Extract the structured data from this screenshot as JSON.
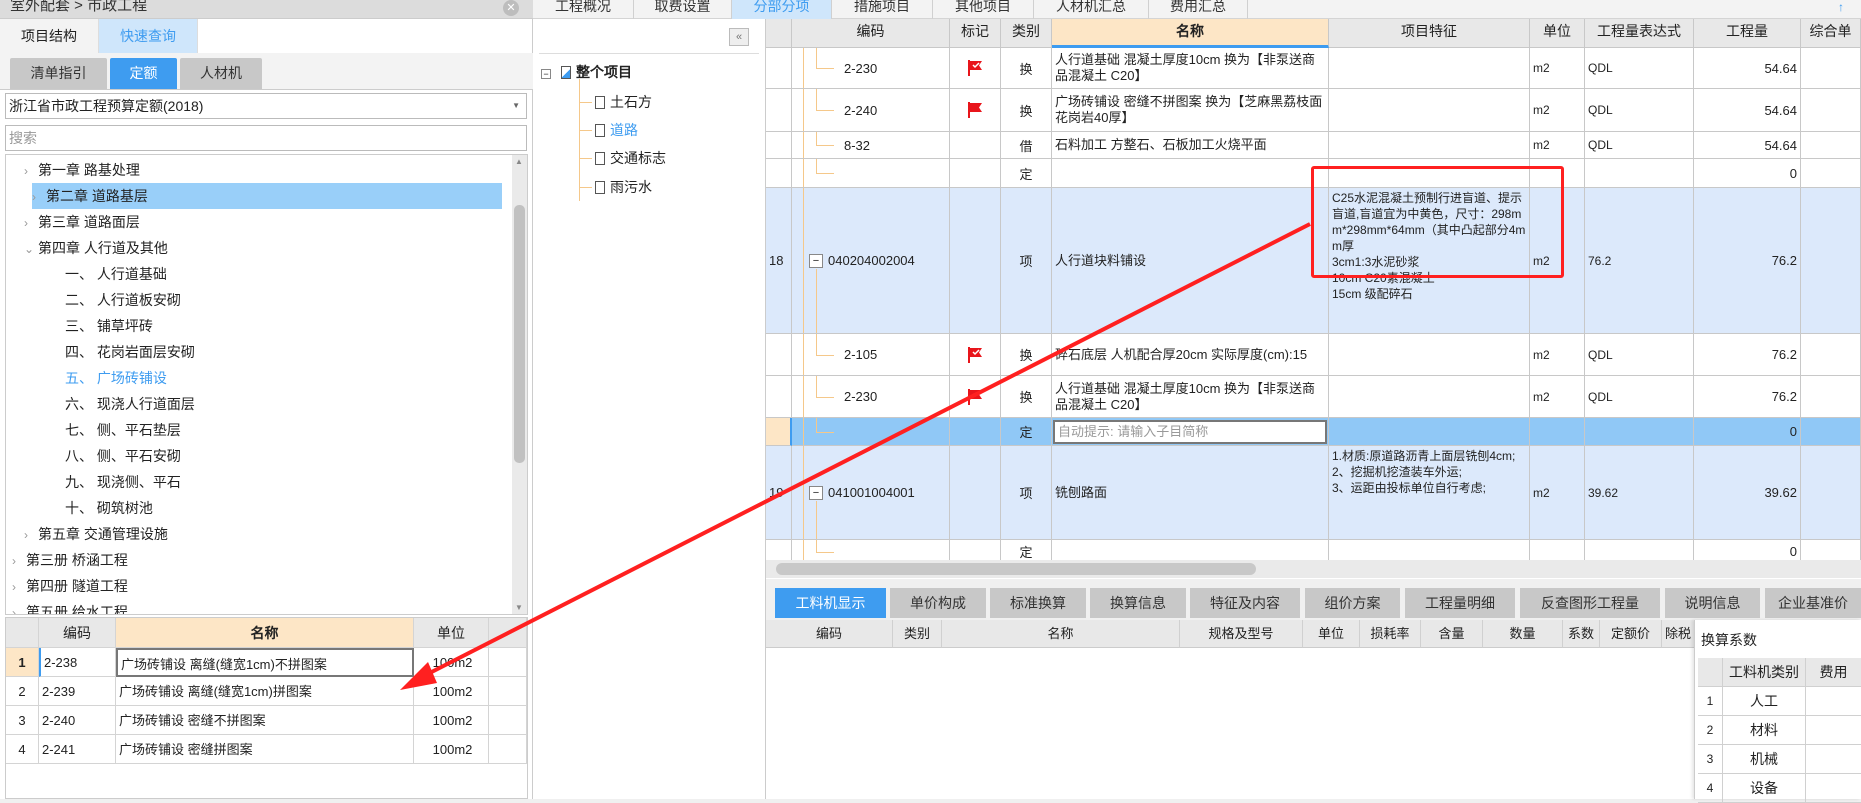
{
  "window": {
    "breadcrumb": "室外配套 > 市政工程",
    "close_icon": "close-circle-icon"
  },
  "top_tabs": [
    {
      "label": "工程概况",
      "active": false
    },
    {
      "label": "取费设置",
      "active": false
    },
    {
      "label": "分部分项",
      "active": true
    },
    {
      "label": "措施项目",
      "active": false
    },
    {
      "label": "其他项目",
      "active": false
    },
    {
      "label": "人材机汇总",
      "active": false
    },
    {
      "label": "费用汇总",
      "active": false
    }
  ],
  "left_panel": {
    "tabs": [
      {
        "label": "项目结构",
        "active": false
      },
      {
        "label": "快速查询",
        "active": true
      }
    ],
    "sub_tabs": [
      {
        "label": "清单指引",
        "active": false
      },
      {
        "label": "定额",
        "active": true
      },
      {
        "label": "人材机",
        "active": false
      }
    ],
    "library": "浙江省市政工程预算定额(2018)",
    "search_placeholder": "搜索",
    "tree": [
      {
        "label": "第一章  路基处理",
        "level": 1,
        "expander": "collapsed"
      },
      {
        "label": "第二章  道路基层",
        "level": 1,
        "expander": "collapsed",
        "highlighted": true
      },
      {
        "label": "第三章  道路面层",
        "level": 1,
        "expander": "collapsed"
      },
      {
        "label": "第四章  人行道及其他",
        "level": 1,
        "expander": "expanded"
      },
      {
        "label": "一、  人行道基础",
        "level": 2
      },
      {
        "label": "二、  人行道板安砌",
        "level": 2
      },
      {
        "label": "三、  铺草坪砖",
        "level": 2
      },
      {
        "label": "四、  花岗岩面层安砌",
        "level": 2
      },
      {
        "label": "五、  广场砖铺设",
        "level": 2,
        "selected": true
      },
      {
        "label": "六、  现浇人行道面层",
        "level": 2
      },
      {
        "label": "七、  侧、平石垫层",
        "level": 2
      },
      {
        "label": "八、  侧、平石安砌",
        "level": 2
      },
      {
        "label": "九、  现浇侧、平石",
        "level": 2
      },
      {
        "label": "十、  砌筑树池",
        "level": 2
      },
      {
        "label": "第五章  交通管理设施",
        "level": 1,
        "expander": "collapsed"
      },
      {
        "label": "第三册  桥涵工程",
        "level": 0,
        "expander": "collapsed"
      },
      {
        "label": "第四册  隧道工程",
        "level": 0,
        "expander": "collapsed"
      },
      {
        "label": "第五册  给水工程",
        "level": 0,
        "expander": "collapsed"
      }
    ],
    "result_table": {
      "headers": [
        "编码",
        "名称",
        "单位"
      ],
      "rows": [
        {
          "index": "1",
          "code": "2-238",
          "name": "广场砖铺设  离缝(缝宽1cm)不拼图案",
          "unit": "100m2"
        },
        {
          "index": "2",
          "code": "2-239",
          "name": "广场砖铺设  离缝(缝宽1cm)拼图案",
          "unit": "100m2"
        },
        {
          "index": "3",
          "code": "2-240",
          "name": "广场砖铺设  密缝不拼图案",
          "unit": "100m2"
        },
        {
          "index": "4",
          "code": "2-241",
          "name": "广场砖铺设  密缝拼图案",
          "unit": "100m2"
        }
      ]
    }
  },
  "project_tree": {
    "root": "整个项目",
    "children": [
      {
        "label": "土石方",
        "selected": false
      },
      {
        "label": "道路",
        "selected": true
      },
      {
        "label": "交通标志",
        "selected": false
      },
      {
        "label": "雨污水",
        "selected": false
      }
    ]
  },
  "main_table": {
    "headers": [
      "",
      "编码",
      "标记",
      "类别",
      "名称",
      "项目特征",
      "单位",
      "工程量表达式",
      "工程量",
      "综合单"
    ],
    "rows": [
      {
        "num": "",
        "code": "2-230",
        "flag": "flag-check",
        "type": "换",
        "name": "人行道基础 混凝土厚度10cm   换为【非泵送商品混凝土 C20】",
        "feature": "",
        "unit": "m2",
        "expr": "QDL",
        "qty": "54.64"
      },
      {
        "num": "",
        "code": "2-240",
        "flag": "flag",
        "type": "换",
        "name": "广场砖铺设 密缝不拼图案   换为【芝麻黑荔枝面花岗岩40厚】",
        "feature": "",
        "unit": "m2",
        "expr": "QDL",
        "qty": "54.64"
      },
      {
        "num": "",
        "code": "8-32",
        "flag": "",
        "type": "借",
        "name": "石料加工 方整石、石板加工火烧平面",
        "feature": "",
        "unit": "m2",
        "expr": "QDL",
        "qty": "54.64"
      },
      {
        "num": "",
        "code": "",
        "flag": "",
        "type": "定",
        "name": "",
        "feature": "",
        "unit": "",
        "expr": "",
        "qty": "0"
      },
      {
        "num": "18",
        "code": "040204002004",
        "flag": "",
        "type": "项",
        "name": "人行道块料铺设",
        "feature": "C25水泥混凝土预制行进盲道、提示盲道,盲道宜为中黄色，尺寸：298mm*298mm*64mm（其中凸起部分4mm厚\n3cm1:3水泥砂浆\n10cm C20素混凝土\n15cm 级配碎石",
        "unit": "m2",
        "expr": "76.2",
        "qty": "76.2",
        "parent": true
      },
      {
        "num": "",
        "code": "2-105",
        "flag": "flag-check",
        "type": "换",
        "name": "碎石底层 人机配合厚20cm   实际厚度(cm):15",
        "feature": "",
        "unit": "m2",
        "expr": "QDL",
        "qty": "76.2"
      },
      {
        "num": "",
        "code": "2-230",
        "flag": "flag-check",
        "type": "换",
        "name": "人行道基础 混凝土厚度10cm   换为【非泵送商品混凝土 C20】",
        "feature": "",
        "unit": "m2",
        "expr": "QDL",
        "qty": "76.2"
      },
      {
        "num": "",
        "code": "",
        "flag": "",
        "type": "定",
        "name": "",
        "name_placeholder": "自动提示: 请输入子目简称",
        "feature": "",
        "unit": "",
        "expr": "",
        "qty": "0",
        "editing": true
      },
      {
        "num": "19",
        "code": "041001004001",
        "flag": "",
        "type": "项",
        "name": "铣刨路面",
        "feature": "1.材质:原道路沥青上面层铣刨4cm;\n2、挖掘机挖渣装车外运;\n3、运距由投标单位自行考虑;",
        "unit": "m2",
        "expr": "39.62",
        "qty": "39.62",
        "parent": true
      },
      {
        "num": "",
        "code": "",
        "flag": "",
        "type": "定",
        "name": "",
        "feature": "",
        "unit": "",
        "expr": "",
        "qty": "0"
      }
    ]
  },
  "bottom_tabs": [
    {
      "label": "工料机显示",
      "active": true
    },
    {
      "label": "单价构成"
    },
    {
      "label": "标准换算"
    },
    {
      "label": "换算信息"
    },
    {
      "label": "特征及内容"
    },
    {
      "label": "组价方案"
    },
    {
      "label": "工程量明细"
    },
    {
      "label": "反查图形工程量"
    },
    {
      "label": "说明信息"
    },
    {
      "label": "企业基准价"
    }
  ],
  "bottom_table_headers": [
    "编码",
    "类别",
    "名称",
    "规格及型号",
    "单位",
    "损耗率",
    "含量",
    "数量",
    "系数",
    "定额价",
    "除税"
  ],
  "conversion_panel": {
    "title": "换算系数",
    "headers": [
      "",
      "工料机类别",
      "费用"
    ],
    "rows": [
      [
        "1",
        "人工"
      ],
      [
        "2",
        "材料"
      ],
      [
        "3",
        "机械"
      ],
      [
        "4",
        "设备"
      ]
    ]
  },
  "colors": {
    "accent": "#3e9cf0",
    "annotation": "#ff2020",
    "selected_row": "#90c8f6",
    "parent_row": "#dce9fb",
    "header_highlight": "#fde6c6"
  }
}
